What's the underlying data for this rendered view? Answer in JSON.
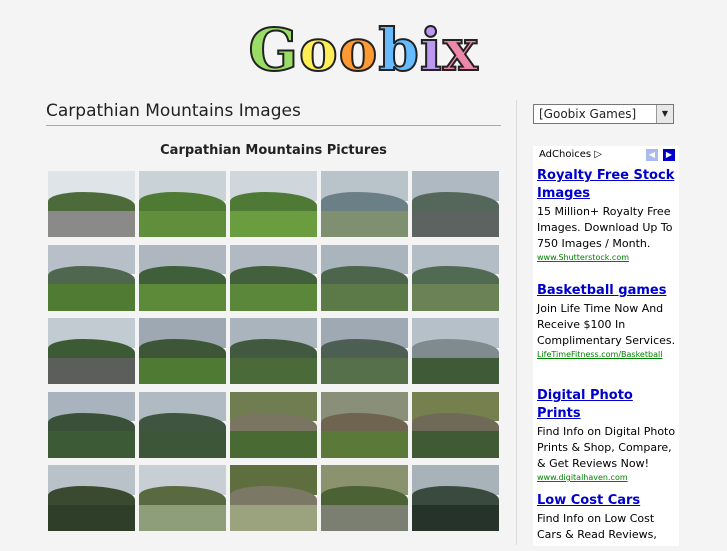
{
  "logo": {
    "letters": [
      "G",
      "o",
      "o",
      "b",
      "i",
      "x"
    ],
    "colors": [
      "#99dd66",
      "#ffee55",
      "#ff9933",
      "#66bbff",
      "#bb99ee",
      "#ee88aa"
    ]
  },
  "page_title": "Carpathian Mountains Images",
  "grid_title": "Carpathian Mountains Pictures",
  "games_select": {
    "selected": "[Goobix Games]"
  },
  "ads": {
    "adchoices_label": "AdChoices",
    "items": [
      {
        "title": "Royalty Free Stock Images",
        "body": "15 Million+ Royalty Free Images. Download Up To 750 Images / Month.",
        "url": "www.Shutterstock.com"
      },
      {
        "title": "Basketball games",
        "body": "Join Life Time Now And Receive $100 In Complimentary Services.",
        "url": "LifeTimeFitness.com/Basketball"
      },
      {
        "title": "Digital Photo Prints",
        "body": "Find Info on Digital Photo Prints & Shop, Compare, & Get Reviews Now!",
        "url": "www.digitalhaven.com"
      },
      {
        "title": "Low Cost Cars",
        "body": "Find Info on Low Cost Cars & Read Reviews,",
        "url": ""
      }
    ]
  },
  "thumbnails": [
    {
      "sky": "#dfe4e8",
      "mid": "#4d6b3a",
      "ground": "#8a8a88"
    },
    {
      "sky": "#c9d2d6",
      "mid": "#4e7a33",
      "ground": "#5f8f3a"
    },
    {
      "sky": "#cfd6dc",
      "mid": "#4f7a35",
      "ground": "#6a9c40"
    },
    {
      "sky": "#b9c3ca",
      "mid": "#6b7f86",
      "ground": "#7e9070"
    },
    {
      "sky": "#aeb9c2",
      "mid": "#55675a",
      "ground": "#5d6360"
    },
    {
      "sky": "#b7c0c8",
      "mid": "#50674f",
      "ground": "#4f7b33"
    },
    {
      "sky": "#aeb7bf",
      "mid": "#3f5f3a",
      "ground": "#5c8a38"
    },
    {
      "sky": "#b1bac2",
      "mid": "#42603b",
      "ground": "#5a8739"
    },
    {
      "sky": "#a9b4bd",
      "mid": "#4c654c",
      "ground": "#5b7a47"
    },
    {
      "sky": "#b3bdc6",
      "mid": "#516a52",
      "ground": "#6a8256"
    },
    {
      "sky": "#c3cbd2",
      "mid": "#3c5a34",
      "ground": "#5b5e5a"
    },
    {
      "sky": "#9ea8b2",
      "mid": "#3e5638",
      "ground": "#4f7a33"
    },
    {
      "sky": "#aab4bd",
      "mid": "#43593f",
      "ground": "#4a6a3a"
    },
    {
      "sky": "#9ea9b3",
      "mid": "#4d5f52",
      "ground": "#55704b"
    },
    {
      "sky": "#b6c0c8",
      "mid": "#7f8b8e",
      "ground": "#3f5a36"
    },
    {
      "sky": "#a8b3bd",
      "mid": "#3a5038",
      "ground": "#3c5a35"
    },
    {
      "sky": "#b0bac3",
      "mid": "#3f5540",
      "ground": "#3c5637"
    },
    {
      "sky": "#6f7d50",
      "mid": "#7a7560",
      "ground": "#4a6a34"
    },
    {
      "sky": "#8a8f7a",
      "mid": "#6e6450",
      "ground": "#5b7a3a"
    },
    {
      "sky": "#75804e",
      "mid": "#6f6a58",
      "ground": "#3f5a34"
    },
    {
      "sky": "#b9c2c9",
      "mid": "#3a4a30",
      "ground": "#2f3e28"
    },
    {
      "sky": "#c7cfd5",
      "mid": "#5a6a40",
      "ground": "#8f9e7a"
    },
    {
      "sky": "#5e6e3e",
      "mid": "#7c7866",
      "ground": "#9aa27e"
    },
    {
      "sky": "#8a936e",
      "mid": "#4b6235",
      "ground": "#7a7f72"
    },
    {
      "sky": "#a8b2b9",
      "mid": "#3a4b3d",
      "ground": "#26332a"
    }
  ]
}
